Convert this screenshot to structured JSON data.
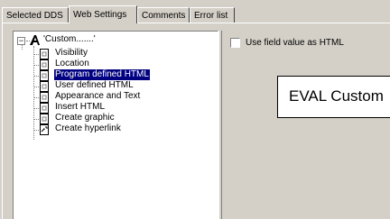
{
  "tabs": [
    {
      "label": "Selected DDS"
    },
    {
      "label": "Web Settings",
      "active": true
    },
    {
      "label": "Comments"
    },
    {
      "label": "Error list"
    }
  ],
  "tree": {
    "root": {
      "label": "'Custom.......'",
      "expander": "−",
      "icon": "script-a-icon"
    },
    "items": [
      {
        "label": "Visibility",
        "icon": "document-icon"
      },
      {
        "label": "Location",
        "icon": "document-icon"
      },
      {
        "label": "Program defined HTML",
        "icon": "document-icon",
        "selected": true
      },
      {
        "label": "User defined HTML",
        "icon": "document-icon"
      },
      {
        "label": "Appearance and Text",
        "icon": "document-icon"
      },
      {
        "label": "Insert HTML",
        "icon": "document-icon"
      },
      {
        "label": "Create graphic",
        "icon": "document-icon"
      },
      {
        "label": "Create hyperlink",
        "icon": "hyperlink-document-icon"
      }
    ]
  },
  "options": {
    "use_field_value_label": "Use field value as HTML",
    "use_field_value_checked": false
  },
  "preview": {
    "text": "EVAL Custom"
  },
  "colors": {
    "selection": "#000080",
    "face": "#d4d0c8"
  }
}
